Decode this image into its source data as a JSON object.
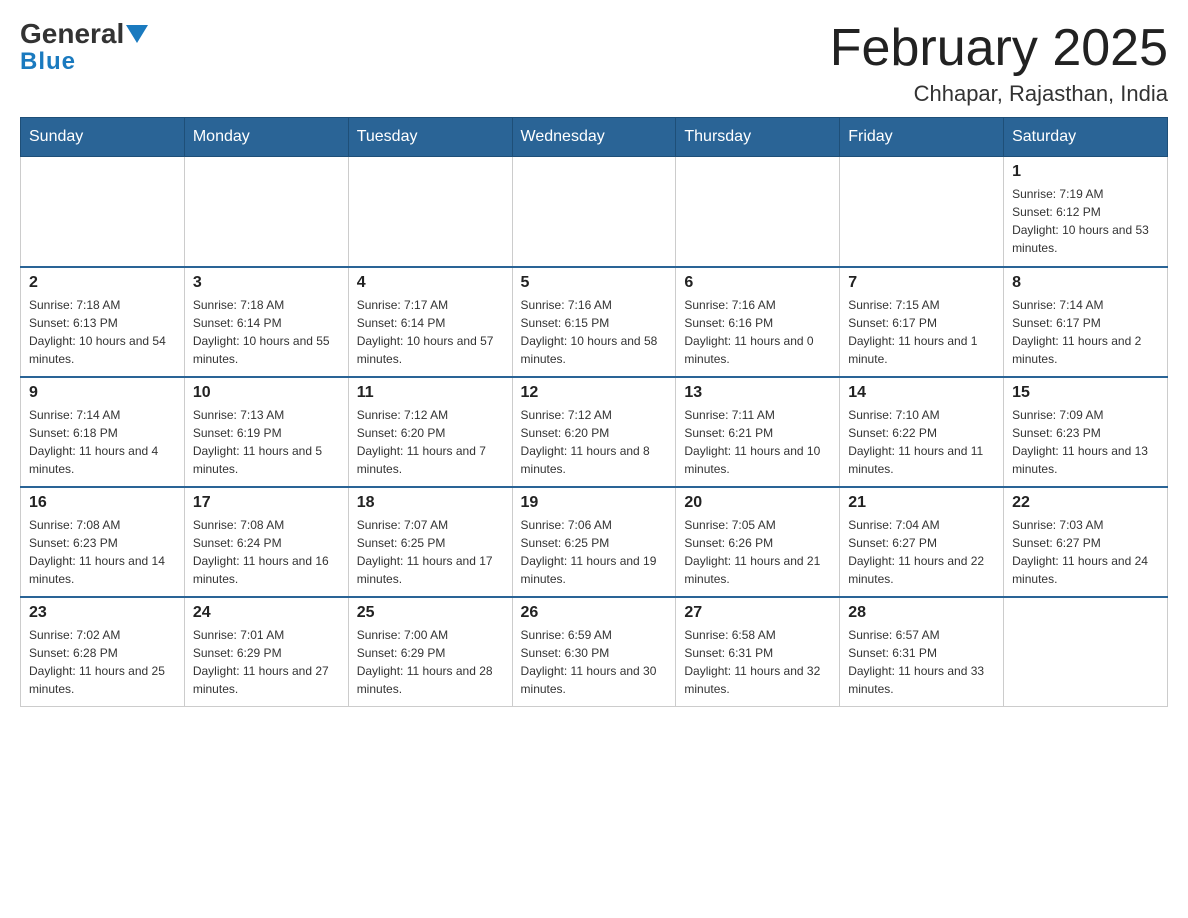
{
  "header": {
    "logo_general": "General",
    "logo_blue": "Blue",
    "month_title": "February 2025",
    "location": "Chhapar, Rajasthan, India"
  },
  "days_of_week": [
    "Sunday",
    "Monday",
    "Tuesday",
    "Wednesday",
    "Thursday",
    "Friday",
    "Saturday"
  ],
  "weeks": [
    {
      "days": [
        {
          "num": "",
          "info": ""
        },
        {
          "num": "",
          "info": ""
        },
        {
          "num": "",
          "info": ""
        },
        {
          "num": "",
          "info": ""
        },
        {
          "num": "",
          "info": ""
        },
        {
          "num": "",
          "info": ""
        },
        {
          "num": "1",
          "info": "Sunrise: 7:19 AM\nSunset: 6:12 PM\nDaylight: 10 hours and 53 minutes."
        }
      ]
    },
    {
      "days": [
        {
          "num": "2",
          "info": "Sunrise: 7:18 AM\nSunset: 6:13 PM\nDaylight: 10 hours and 54 minutes."
        },
        {
          "num": "3",
          "info": "Sunrise: 7:18 AM\nSunset: 6:14 PM\nDaylight: 10 hours and 55 minutes."
        },
        {
          "num": "4",
          "info": "Sunrise: 7:17 AM\nSunset: 6:14 PM\nDaylight: 10 hours and 57 minutes."
        },
        {
          "num": "5",
          "info": "Sunrise: 7:16 AM\nSunset: 6:15 PM\nDaylight: 10 hours and 58 minutes."
        },
        {
          "num": "6",
          "info": "Sunrise: 7:16 AM\nSunset: 6:16 PM\nDaylight: 11 hours and 0 minutes."
        },
        {
          "num": "7",
          "info": "Sunrise: 7:15 AM\nSunset: 6:17 PM\nDaylight: 11 hours and 1 minute."
        },
        {
          "num": "8",
          "info": "Sunrise: 7:14 AM\nSunset: 6:17 PM\nDaylight: 11 hours and 2 minutes."
        }
      ]
    },
    {
      "days": [
        {
          "num": "9",
          "info": "Sunrise: 7:14 AM\nSunset: 6:18 PM\nDaylight: 11 hours and 4 minutes."
        },
        {
          "num": "10",
          "info": "Sunrise: 7:13 AM\nSunset: 6:19 PM\nDaylight: 11 hours and 5 minutes."
        },
        {
          "num": "11",
          "info": "Sunrise: 7:12 AM\nSunset: 6:20 PM\nDaylight: 11 hours and 7 minutes."
        },
        {
          "num": "12",
          "info": "Sunrise: 7:12 AM\nSunset: 6:20 PM\nDaylight: 11 hours and 8 minutes."
        },
        {
          "num": "13",
          "info": "Sunrise: 7:11 AM\nSunset: 6:21 PM\nDaylight: 11 hours and 10 minutes."
        },
        {
          "num": "14",
          "info": "Sunrise: 7:10 AM\nSunset: 6:22 PM\nDaylight: 11 hours and 11 minutes."
        },
        {
          "num": "15",
          "info": "Sunrise: 7:09 AM\nSunset: 6:23 PM\nDaylight: 11 hours and 13 minutes."
        }
      ]
    },
    {
      "days": [
        {
          "num": "16",
          "info": "Sunrise: 7:08 AM\nSunset: 6:23 PM\nDaylight: 11 hours and 14 minutes."
        },
        {
          "num": "17",
          "info": "Sunrise: 7:08 AM\nSunset: 6:24 PM\nDaylight: 11 hours and 16 minutes."
        },
        {
          "num": "18",
          "info": "Sunrise: 7:07 AM\nSunset: 6:25 PM\nDaylight: 11 hours and 17 minutes."
        },
        {
          "num": "19",
          "info": "Sunrise: 7:06 AM\nSunset: 6:25 PM\nDaylight: 11 hours and 19 minutes."
        },
        {
          "num": "20",
          "info": "Sunrise: 7:05 AM\nSunset: 6:26 PM\nDaylight: 11 hours and 21 minutes."
        },
        {
          "num": "21",
          "info": "Sunrise: 7:04 AM\nSunset: 6:27 PM\nDaylight: 11 hours and 22 minutes."
        },
        {
          "num": "22",
          "info": "Sunrise: 7:03 AM\nSunset: 6:27 PM\nDaylight: 11 hours and 24 minutes."
        }
      ]
    },
    {
      "days": [
        {
          "num": "23",
          "info": "Sunrise: 7:02 AM\nSunset: 6:28 PM\nDaylight: 11 hours and 25 minutes."
        },
        {
          "num": "24",
          "info": "Sunrise: 7:01 AM\nSunset: 6:29 PM\nDaylight: 11 hours and 27 minutes."
        },
        {
          "num": "25",
          "info": "Sunrise: 7:00 AM\nSunset: 6:29 PM\nDaylight: 11 hours and 28 minutes."
        },
        {
          "num": "26",
          "info": "Sunrise: 6:59 AM\nSunset: 6:30 PM\nDaylight: 11 hours and 30 minutes."
        },
        {
          "num": "27",
          "info": "Sunrise: 6:58 AM\nSunset: 6:31 PM\nDaylight: 11 hours and 32 minutes."
        },
        {
          "num": "28",
          "info": "Sunrise: 6:57 AM\nSunset: 6:31 PM\nDaylight: 11 hours and 33 minutes."
        },
        {
          "num": "",
          "info": ""
        }
      ]
    }
  ]
}
